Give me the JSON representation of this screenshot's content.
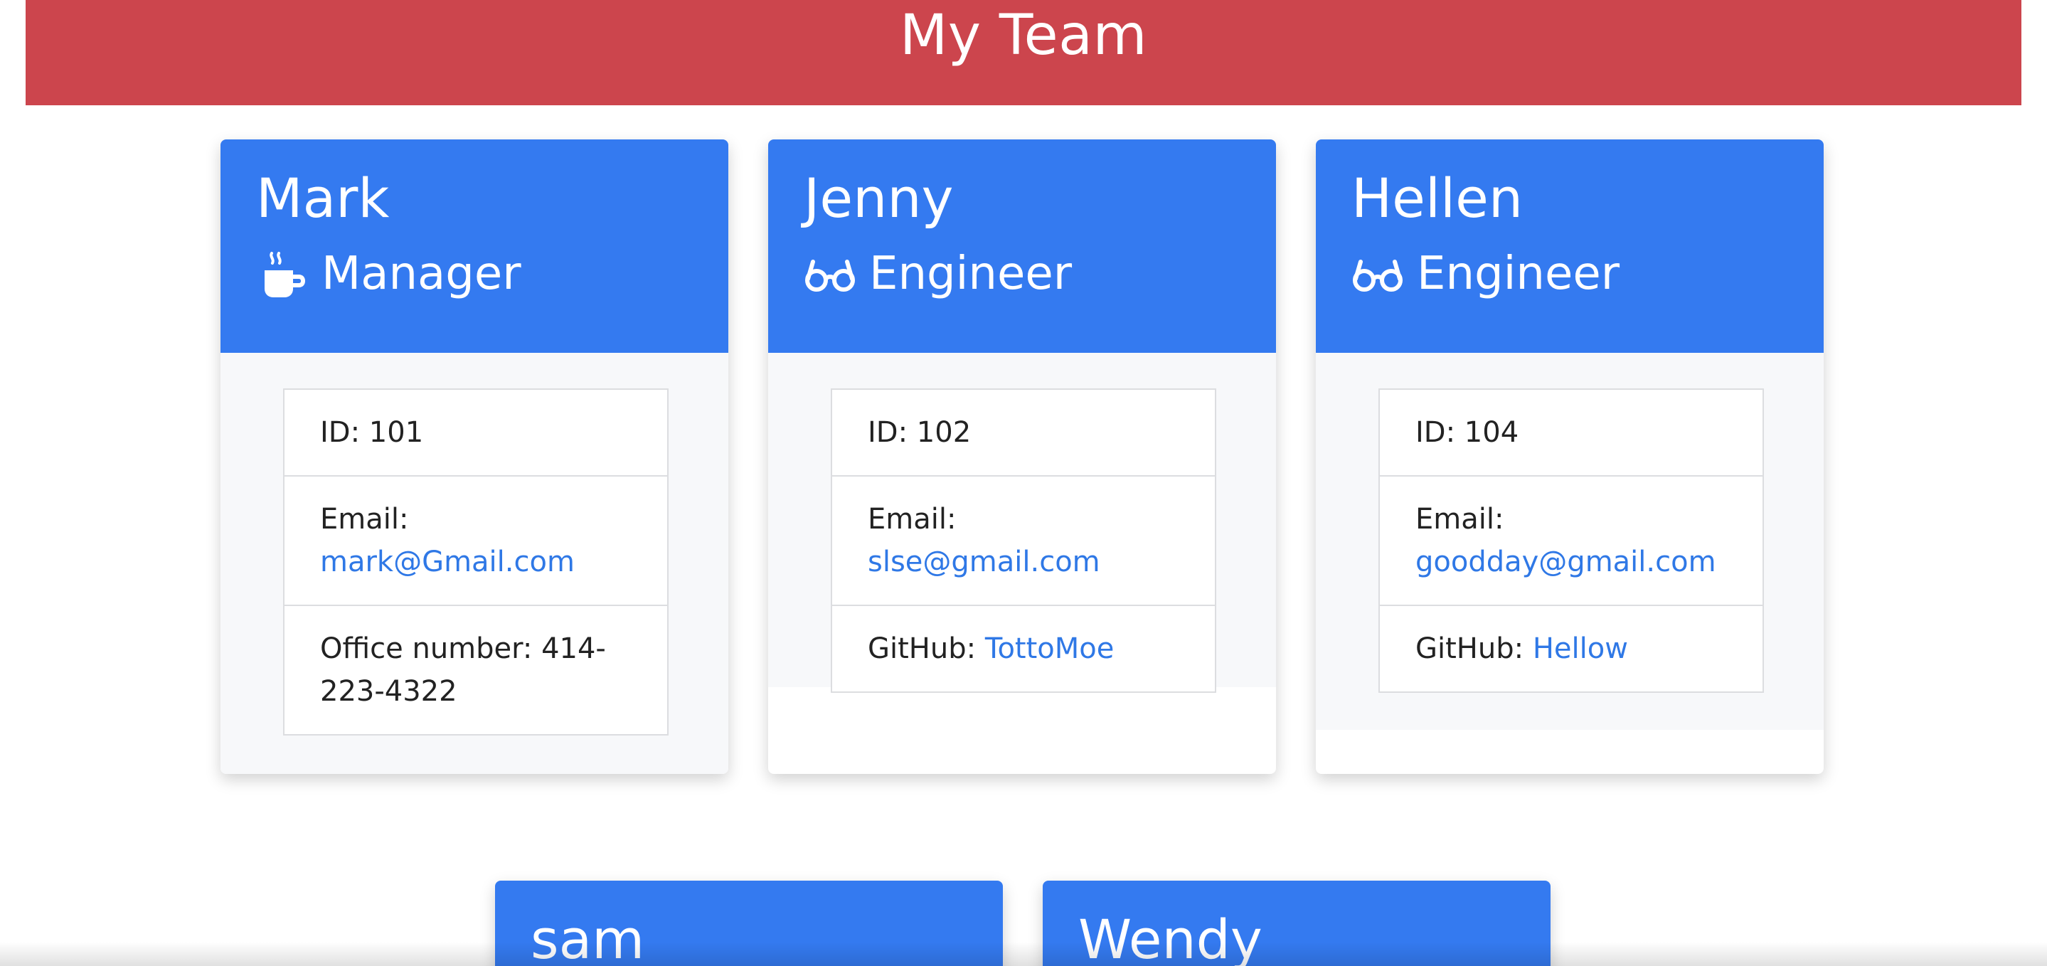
{
  "page": {
    "title": "My Team"
  },
  "cards": [
    {
      "name": "Mark",
      "role": "Manager",
      "icon": "mug-icon",
      "items": [
        {
          "label": "ID:",
          "value": "101"
        },
        {
          "label": "Email:",
          "value": "mark@Gmail.com"
        },
        {
          "label": "Office number:",
          "value": "414-223-4322"
        }
      ]
    },
    {
      "name": "Jenny",
      "role": "Engineer",
      "icon": "glasses-icon",
      "items": [
        {
          "label": "ID:",
          "value": "102"
        },
        {
          "label": "Email:",
          "value": "slse@gmail.com"
        },
        {
          "label": "GitHub:",
          "value": "TottoMoe"
        }
      ]
    },
    {
      "name": "Hellen",
      "role": "Engineer",
      "icon": "glasses-icon",
      "items": [
        {
          "label": "ID:",
          "value": "104"
        },
        {
          "label": "Email:",
          "value": "goodday@gmail.com"
        },
        {
          "label": "GitHub:",
          "value": "Hellow"
        }
      ]
    },
    {
      "name": "sam",
      "role": "",
      "icon": "",
      "items": []
    },
    {
      "name": "Wendy",
      "role": "",
      "icon": "",
      "items": []
    }
  ],
  "colors": {
    "header_bg": "#cc454d",
    "card_header_bg": "#347af0",
    "link": "#2f78e6",
    "card_body_bg": "#f7f8fa"
  }
}
